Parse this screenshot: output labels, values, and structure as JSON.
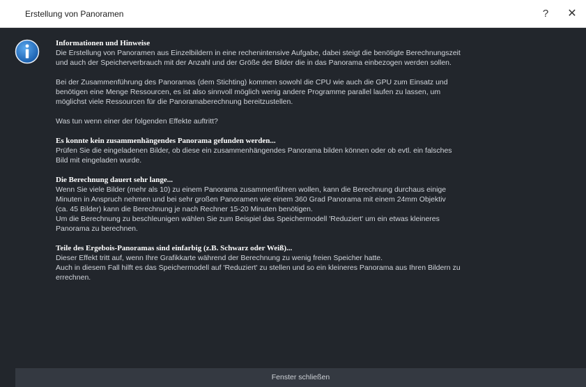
{
  "window": {
    "title": "Erstellung von Panoramen",
    "help_label": "?",
    "close_label": "✕"
  },
  "icon": {
    "name": "info-icon",
    "color": "#1f74c8"
  },
  "content": {
    "intro_heading": "Informationen und Hinweise",
    "intro_lines": [
      "Die Erstellung von Panoramen aus Einzelbildern in eine rechenintensive Aufgabe, dabei steigt die benötigte Berechnungszeit",
      "und auch der Speicherverbrauch mit der Anzahl und der Größe der Bilder die in das Panorama einbezogen werden sollen."
    ],
    "stitching_lines": [
      "Bei der Zusammenführung des Panoramas (dem Stichting) kommen sowohl die CPU wie auch die GPU zum Einsatz und",
      "benötigen eine Menge Ressourcen, es ist also sinnvoll möglich wenig andere Programme parallel laufen zu lassen, um",
      "möglichst viele Ressourcen für die Panoramaberechnung bereitzustellen."
    ],
    "question": "Was tun wenn einer der folgenden Effekte auftritt?",
    "section1_heading": "Es konnte kein zusammenhängendes Panorama gefunden werden...",
    "section1_lines": [
      "Prüfen Sie die eingeladenen Bilder, ob diese ein zusammenhängendes Panorama bilden können oder ob evtl. ein falsches",
      "Bild mit eingeladen wurde."
    ],
    "section2_heading": "Die Berechnung dauert sehr lange...",
    "section2_lines": [
      "Wenn Sie viele Bilder (mehr als 10) zu einem Panorama zusammenführen wollen, kann die Berechnung durchaus einige",
      "Minuten in Anspruch nehmen und bei sehr großen Panoramen wie einem 360 Grad Panorama mit einem 24mm Objektiv",
      "(ca. 45 Bilder) kann die Berechnung je nach Rechner 15-20 Minuten benötigen.",
      "Um die Berechnung zu beschleunigen wählen Sie zum Beispiel das Speichermodell 'Reduziert' um ein etwas kleineres",
      "Panorama zu berechnen."
    ],
    "section3_heading": "Teile des Ergebois-Panoramas sind einfarbig (z.B. Schwarz oder Weiß)...",
    "section3_lines": [
      "Dieser Effekt tritt auf, wenn Ihre Grafikkarte während der Berechnung zu wenig freien Speicher hatte.",
      "Auch in diesem Fall hilft es das Speichermodell auf 'Reduziert' zu stellen und so ein kleineres Panorama aus Ihren Bildern zu",
      "errechnen."
    ]
  },
  "footer": {
    "close_button_label": "Fenster schließen"
  }
}
